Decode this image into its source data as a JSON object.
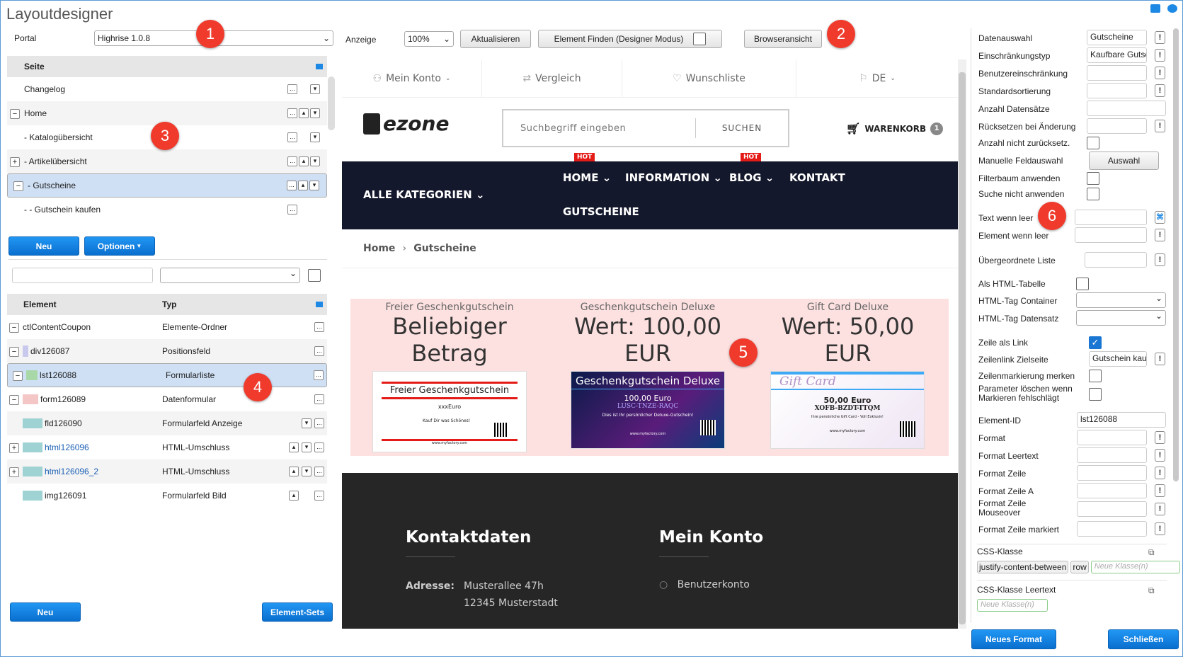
{
  "app": {
    "title": "Layoutdesigner"
  },
  "toolbar": {
    "portal_label": "Portal",
    "portal_value": "Highrise 1.0.8",
    "anzeige_label": "Anzeige",
    "zoom_value": "100%",
    "refresh_label": "Aktualisieren",
    "find_label": "Element Finden (Designer Modus)",
    "browser_label": "Browseransicht"
  },
  "badges": [
    "1",
    "2",
    "3",
    "4",
    "5",
    "6"
  ],
  "pages_tree": {
    "header": "Seite",
    "rows": [
      {
        "label": "Changelog"
      },
      {
        "label": "Home"
      },
      {
        "label": "- Katalogübersicht"
      },
      {
        "label": "- Artikelübersicht"
      },
      {
        "label": "- Gutscheine"
      },
      {
        "label": "- - Gutschein kaufen"
      }
    ],
    "new_label": "Neu",
    "options_label": "Optionen"
  },
  "elements_table": {
    "col_element": "Element",
    "col_type": "Typ",
    "rows": [
      {
        "name": "ctlContentCoupon",
        "type": "Elemente-Ordner"
      },
      {
        "name": "div126087",
        "type": "Positionsfeld"
      },
      {
        "name": "lst126088",
        "type": "Formularliste"
      },
      {
        "name": "form126089",
        "type": "Datenformular"
      },
      {
        "name": "fld126090",
        "type": "Formularfeld Anzeige"
      },
      {
        "name": "html126096",
        "type": "HTML-Umschluss"
      },
      {
        "name": "html126096_2",
        "type": "HTML-Umschluss"
      },
      {
        "name": "img126091",
        "type": "Formularfeld Bild"
      }
    ],
    "new_label": "Neu",
    "sets_label": "Element-Sets"
  },
  "preview": {
    "topbar": {
      "account": "Mein Konto",
      "compare": "Vergleich",
      "wishlist": "Wunschliste",
      "lang": "DE"
    },
    "logo": "ezone",
    "search_placeholder": "Suchbegriff eingeben",
    "search_button": "SUCHEN",
    "cart_label": "WARENKORB",
    "cart_count": "1",
    "nav": {
      "all_categories": "ALLE KATEGORIEN",
      "home": "HOME",
      "information": "INFORMATION",
      "blog": "BLOG",
      "contact": "KONTAKT",
      "vouchers": "GUTSCHEINE",
      "hot": "HOT"
    },
    "breadcrumb": {
      "home": "Home",
      "current": "Gutscheine"
    },
    "vouchers": [
      {
        "subtitle": "Freier Geschenkgutschein",
        "title1": "Beliebiger",
        "title2": "Betrag",
        "card_title": "Freier Geschenkgutschein",
        "card_amount": "xxxEuro",
        "card_text": "Kauf Dir was Schönes!",
        "card_footer": "www.myfactory.com"
      },
      {
        "subtitle": "Geschenkgutschein Deluxe",
        "title1": "Wert: 100,00",
        "title2": "EUR",
        "card_title": "Geschenkgutschein Deluxe",
        "card_amount": "100,00 Euro",
        "card_code": "LUSC-TNZE-RAQC",
        "card_text": "Dies ist Ihr persönlicher Deluxe-Gutschein!",
        "card_footer": "www.myfactory.com"
      },
      {
        "subtitle": "Gift Card Deluxe",
        "title1": "Wert: 50,00",
        "title2": "EUR",
        "card_title": "Gift Card",
        "card_amount": "50,00 Euro",
        "card_code": "XOFB-BZDT-TTQM",
        "card_text": "Ihre persönliche Gift Card - Voll Exklusiv!",
        "card_footer": "www.myfactory.com"
      }
    ],
    "footer": {
      "contact_title": "Kontaktdaten",
      "account_title": "Mein Konto",
      "address_label": "Adresse:",
      "address_line1": "Musterallee 47h",
      "address_line2": "12345 Musterstadt",
      "account_link": "Benutzerkonto"
    }
  },
  "props": {
    "datenauswahl": {
      "label": "Datenauswahl",
      "value": "Gutscheine"
    },
    "einschraenkungstyp": {
      "label": "Einschränkungstyp",
      "value": "Kaufbare Gutsc"
    },
    "benutzereinschraenkung": {
      "label": "Benutzereinschränkung"
    },
    "standardsortierung": {
      "label": "Standardsortierung"
    },
    "anzahl_datensaetze": {
      "label": "Anzahl Datensätze"
    },
    "ruecksetzen": {
      "label": "Rücksetzen bei Änderung"
    },
    "anzahl_nicht_zurueck": {
      "label": "Anzahl nicht zurücksetz."
    },
    "manuelle_feldauswahl": {
      "label": "Manuelle Feldauswahl",
      "button": "Auswahl"
    },
    "filterbaum": {
      "label": "Filterbaum anwenden"
    },
    "suche_nicht": {
      "label": "Suche nicht anwenden"
    },
    "text_wenn_leer": {
      "label": "Text wenn leer"
    },
    "element_wenn_leer": {
      "label": "Element wenn leer"
    },
    "uebergeordnete_liste": {
      "label": "Übergeordnete Liste"
    },
    "als_html_tabelle": {
      "label": "Als HTML-Tabelle"
    },
    "html_tag_container": {
      "label": "HTML-Tag Container"
    },
    "html_tag_datensatz": {
      "label": "HTML-Tag Datensatz"
    },
    "zeile_als_link": {
      "label": "Zeile als Link"
    },
    "zeilenlink_zielseite": {
      "label": "Zeilenlink Zielseite",
      "value": "Gutschein kau"
    },
    "zeilenmarkierung": {
      "label": "Zeilenmarkierung merken"
    },
    "parameter_loeschen": {
      "label1": "Parameter löschen wenn",
      "label2": "Markieren fehlschlägt"
    },
    "element_id": {
      "label": "Element-ID",
      "value": "lst126088"
    },
    "format": {
      "label": "Format"
    },
    "format_leertext": {
      "label": "Format Leertext"
    },
    "format_zeile": {
      "label": "Format Zeile"
    },
    "format_zeile_a": {
      "label": "Format Zeile A"
    },
    "format_zeile_mouseover": {
      "label1": "Format Zeile",
      "label2": "Mouseover"
    },
    "format_zeile_markiert": {
      "label": "Format Zeile markiert"
    },
    "css_klasse": {
      "label": "CSS-Klasse",
      "tags": [
        "justify-content-between",
        "row"
      ],
      "new_placeholder": "Neue Klasse(n)"
    },
    "css_klasse_leertext": {
      "label": "CSS-Klasse Leertext",
      "new_placeholder": "Neue Klasse(n)"
    },
    "new_format_label": "Neues Format",
    "close_label": "Schließen",
    "ex_mark": "!",
    "dots": "..."
  },
  "colors": {
    "accent": "#1a7fd8",
    "badge": "#ef3a2c",
    "selected_row": "#cfe0f5",
    "nav_dark": "#14182c",
    "voucher_bg": "#fde0e0"
  }
}
